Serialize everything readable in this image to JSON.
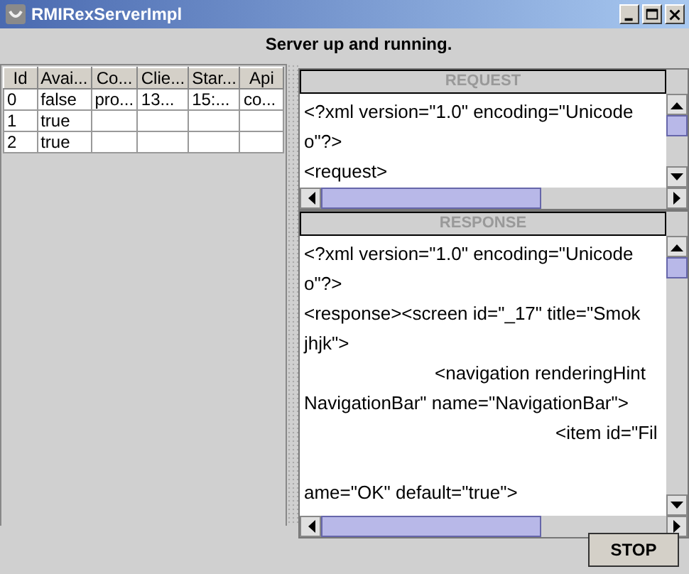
{
  "window": {
    "title": "RMIRexServerImpl"
  },
  "status": "Server up and running.",
  "table": {
    "columns": [
      "Id",
      "Avai...",
      "Co...",
      "Clie...",
      "Star...",
      "Api"
    ],
    "rows": [
      [
        "0",
        "false",
        "pro...",
        "13...",
        "15:...",
        "co..."
      ],
      [
        "1",
        "true",
        "",
        "",
        "",
        ""
      ],
      [
        "2",
        "true",
        "",
        "",
        "",
        ""
      ]
    ]
  },
  "request": {
    "title": "REQUEST",
    "lines": [
      {
        "kind": "plain",
        "text": "<?xml version=\"1.0\" encoding=\"Unicode"
      },
      {
        "kind": "plain",
        "text": "o\"?>"
      },
      {
        "kind": "plain",
        "text": "<request>"
      }
    ]
  },
  "response": {
    "title": "RESPONSE",
    "lines": [
      {
        "kind": "plain",
        "text": "<?xml version=\"1.0\" encoding=\"Unicode"
      },
      {
        "kind": "plain",
        "text": "o\"?>"
      },
      {
        "kind": "plain",
        "text": "<response><screen id=\"_17\" title=\"Smok"
      },
      {
        "kind": "plain",
        "text": "jhjk\">"
      },
      {
        "kind": "indent1",
        "text": "<navigation renderingHint"
      },
      {
        "kind": "plain",
        "text": "NavigationBar\" name=\"NavigationBar\">"
      },
      {
        "kind": "indent2",
        "text": "<item id=\"Fil"
      },
      {
        "kind": "blank"
      },
      {
        "kind": "plain",
        "text": "ame=\"OK\" default=\"true\">"
      }
    ]
  },
  "buttons": [
    "STOP"
  ]
}
